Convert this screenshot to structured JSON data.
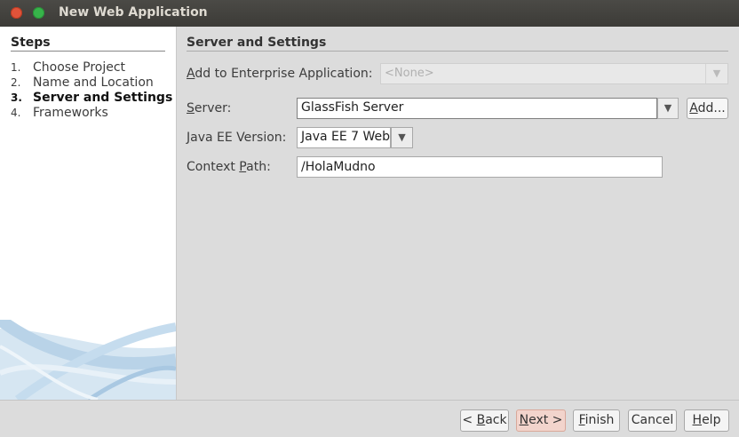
{
  "window": {
    "title": "New Web Application"
  },
  "steps": {
    "heading": "Steps",
    "items": [
      {
        "num": "1.",
        "label": "Choose Project"
      },
      {
        "num": "2.",
        "label": "Name and Location"
      },
      {
        "num": "3.",
        "label": "Server and Settings",
        "current": true
      },
      {
        "num": "4.",
        "label": "Frameworks"
      }
    ]
  },
  "main": {
    "section_title": "Server and Settings",
    "enterprise": {
      "label_mn": "A",
      "label_rest": "dd to Enterprise Application:",
      "value": "<None>",
      "enabled": false
    },
    "server": {
      "label_mn": "S",
      "label_rest": "erver:",
      "value": "GlassFish Server",
      "add_mn": "A",
      "add_rest": "dd..."
    },
    "ee_version": {
      "label_mn": "J",
      "label_rest": "ava EE Version:",
      "value": "Java EE 7 Web"
    },
    "context_path": {
      "label_pre": "Context ",
      "label_mn": "P",
      "label_rest": "ath:",
      "value": "/HolaMudno"
    }
  },
  "buttons": {
    "back": {
      "pre": "< ",
      "mn": "B",
      "rest": "ack"
    },
    "next": {
      "pre": "",
      "mn": "N",
      "rest": "ext >"
    },
    "finish": {
      "pre": "",
      "mn": "F",
      "rest": "inish"
    },
    "cancel": {
      "pre": "",
      "mn": "",
      "rest": "Cancel"
    },
    "help": {
      "pre": "",
      "mn": "H",
      "rest": "elp"
    }
  },
  "colors": {
    "primary_button": "#f2d4cc",
    "titlebar": "#3c3b37",
    "close": "#e0533a",
    "maximize": "#37b34a"
  }
}
